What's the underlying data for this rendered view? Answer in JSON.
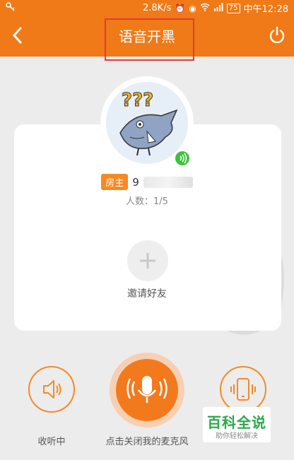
{
  "status_bar": {
    "net_speed": "2.8K/s",
    "battery": "75",
    "time": "中午12:28"
  },
  "header": {
    "title": "语音开黑"
  },
  "room": {
    "owner_tag": "房主",
    "owner_name_visible": "9",
    "member_count": "人数：1/5",
    "invite_label": "邀请好友"
  },
  "controls": {
    "listen_label": "收听中",
    "mic_label": "点击关闭我的麦克风"
  },
  "watermark": {
    "title": "百科全说",
    "subtitle": "助你轻松解决"
  },
  "colors": {
    "accent": "#f07a17",
    "highlight_box": "#e23b3b",
    "voice_badge": "#3ec23e"
  }
}
